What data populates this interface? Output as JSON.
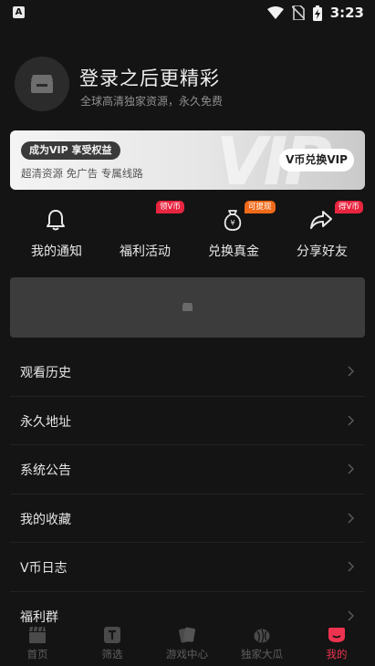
{
  "status_bar": {
    "time": "3:23",
    "app_icon_letter": "A"
  },
  "profile": {
    "title": "登录之后更精彩",
    "subtitle": "全球高清独家资源，永久免费"
  },
  "vip_card": {
    "badge": "成为VIP 享受权益",
    "perks": "超清资源  免广告  专属线路",
    "button": "V币兑换VIP",
    "watermark": "VIP"
  },
  "quick_actions": [
    {
      "label": "我的通知",
      "icon": "bell-icon",
      "badge": ""
    },
    {
      "label": "福利活动",
      "icon": "",
      "badge": "领V币",
      "badge_color": "#e8253f"
    },
    {
      "label": "兑换真金",
      "icon": "money-bag-icon",
      "badge": "可提现",
      "badge_color": "#f06a1a"
    },
    {
      "label": "分享好友",
      "icon": "share-icon",
      "badge": "得V币",
      "badge_color": "#e8253f"
    }
  ],
  "menu": [
    {
      "label": "观看历史"
    },
    {
      "label": "永久地址"
    },
    {
      "label": "系统公告"
    },
    {
      "label": "我的收藏"
    },
    {
      "label": "V币日志"
    },
    {
      "label": "福利群"
    }
  ],
  "tabs": [
    {
      "label": "首页",
      "icon": "clapper-icon",
      "active": false
    },
    {
      "label": "筛选",
      "icon": "filter-t-icon",
      "active": false
    },
    {
      "label": "游戏中心",
      "icon": "cards-icon",
      "active": false
    },
    {
      "label": "独家大瓜",
      "icon": "melon-icon",
      "active": false
    },
    {
      "label": "我的",
      "icon": "mine-icon",
      "active": true
    }
  ],
  "colors": {
    "accent": "#ee3350",
    "background": "#141414"
  }
}
